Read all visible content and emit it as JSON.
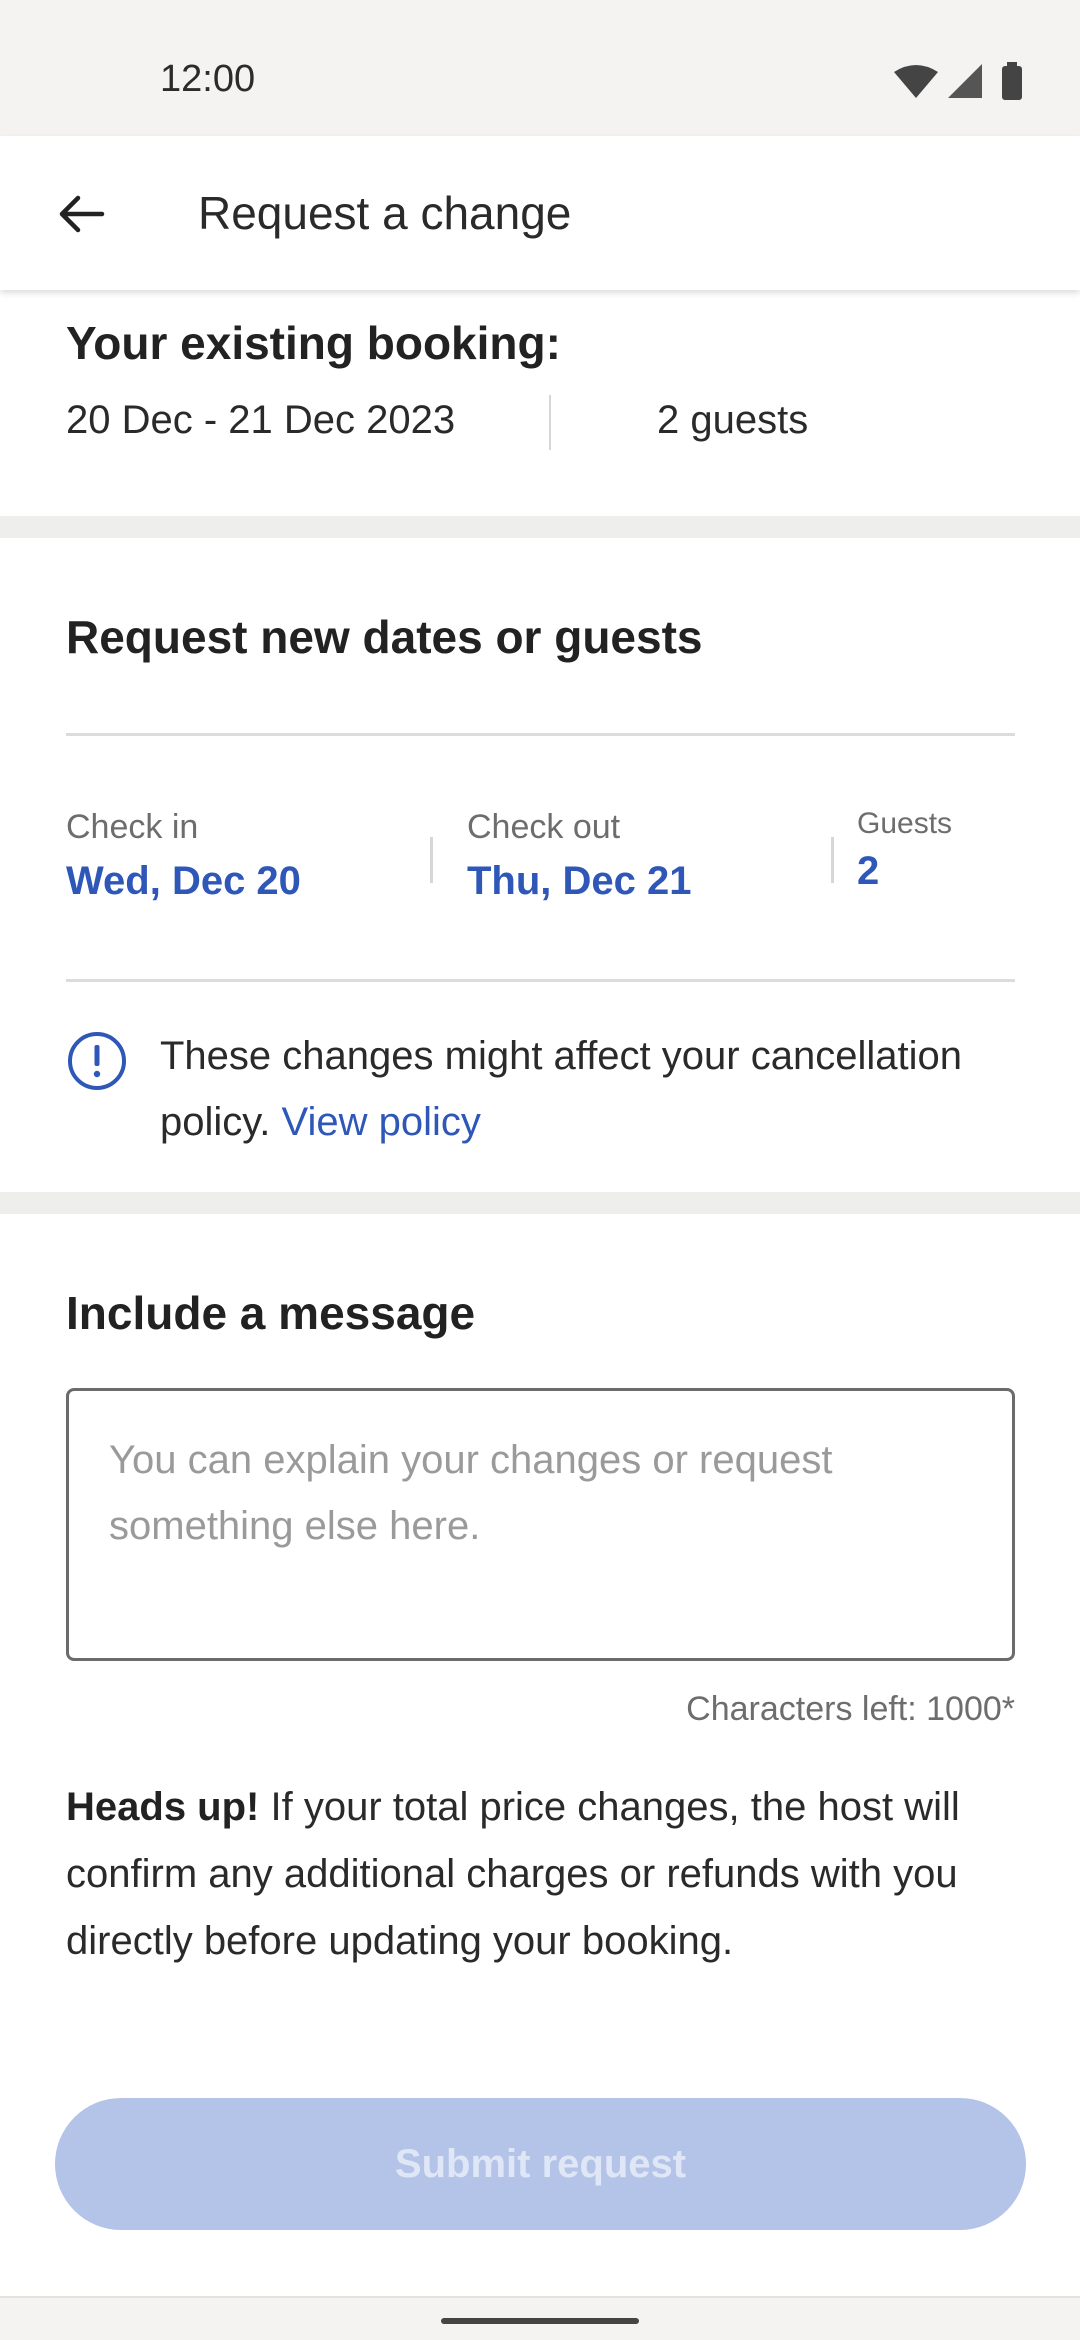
{
  "status_bar": {
    "time": "12:00",
    "icons": [
      "wifi-icon",
      "signal-icon",
      "battery-icon"
    ]
  },
  "app_bar": {
    "back_icon": "arrow-left-icon",
    "title": "Request a change"
  },
  "existing_booking": {
    "title": "Your existing booking:",
    "dates": "20 Dec - 21 Dec 2023",
    "guests": "2 guests"
  },
  "new_request": {
    "title": "Request new dates or guests",
    "check_in": {
      "label": "Check in",
      "value": "Wed, Dec 20"
    },
    "check_out": {
      "label": "Check out",
      "value": "Thu, Dec 21"
    },
    "guests": {
      "label": "Guests",
      "value": "2"
    }
  },
  "notice": {
    "icon": "info-circle-icon",
    "text": "These changes might affect your cancellation policy.",
    "link": "View policy"
  },
  "message": {
    "title": "Include a message",
    "value": "",
    "placeholder": "You can explain your changes or request something else here.",
    "char_count": "Characters left: 1000*"
  },
  "heads_up": {
    "bold": "Heads up!",
    "text": "If your total price changes, the host will confirm any additional charges or refunds with you directly before updating your booking."
  },
  "submit": {
    "label": "Submit request",
    "enabled": false
  },
  "colors": {
    "accent": "#2f57b8",
    "submit_disabled_bg": "#b4c4e8",
    "separator_band": "#eeeeed",
    "status_bar_bg": "#f4f3f2"
  }
}
